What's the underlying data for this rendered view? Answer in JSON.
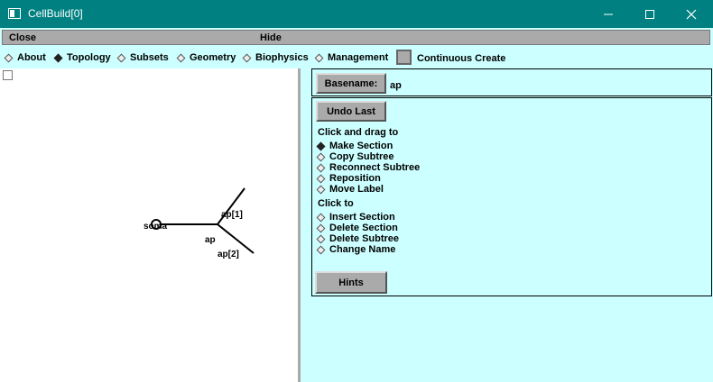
{
  "window": {
    "title": "CellBuild[0]"
  },
  "menu": {
    "close": "Close",
    "hide": "Hide"
  },
  "tabs": [
    {
      "label": "About",
      "selected": false
    },
    {
      "label": "Topology",
      "selected": true
    },
    {
      "label": "Subsets",
      "selected": false
    },
    {
      "label": "Geometry",
      "selected": false
    },
    {
      "label": "Biophysics",
      "selected": false
    },
    {
      "label": "Management",
      "selected": false
    }
  ],
  "continuous_create": {
    "label": "Continuous Create"
  },
  "canvas": {
    "labels": {
      "soma": "soma",
      "ap": "ap",
      "ap1": "ap[1]",
      "ap2": "ap[2]"
    }
  },
  "basename": {
    "button": "Basename:",
    "value": "ap"
  },
  "undo": {
    "label": "Undo Last"
  },
  "drag": {
    "header": "Click and drag to",
    "options": [
      "Make Section",
      "Copy Subtree",
      "Reconnect Subtree",
      "Reposition",
      "Move Label"
    ],
    "selected": "Make Section"
  },
  "click": {
    "header": "Click to",
    "options": [
      "Insert Section",
      "Delete Section",
      "Delete Subtree",
      "Change Name"
    ]
  },
  "hints": {
    "label": "Hints"
  }
}
